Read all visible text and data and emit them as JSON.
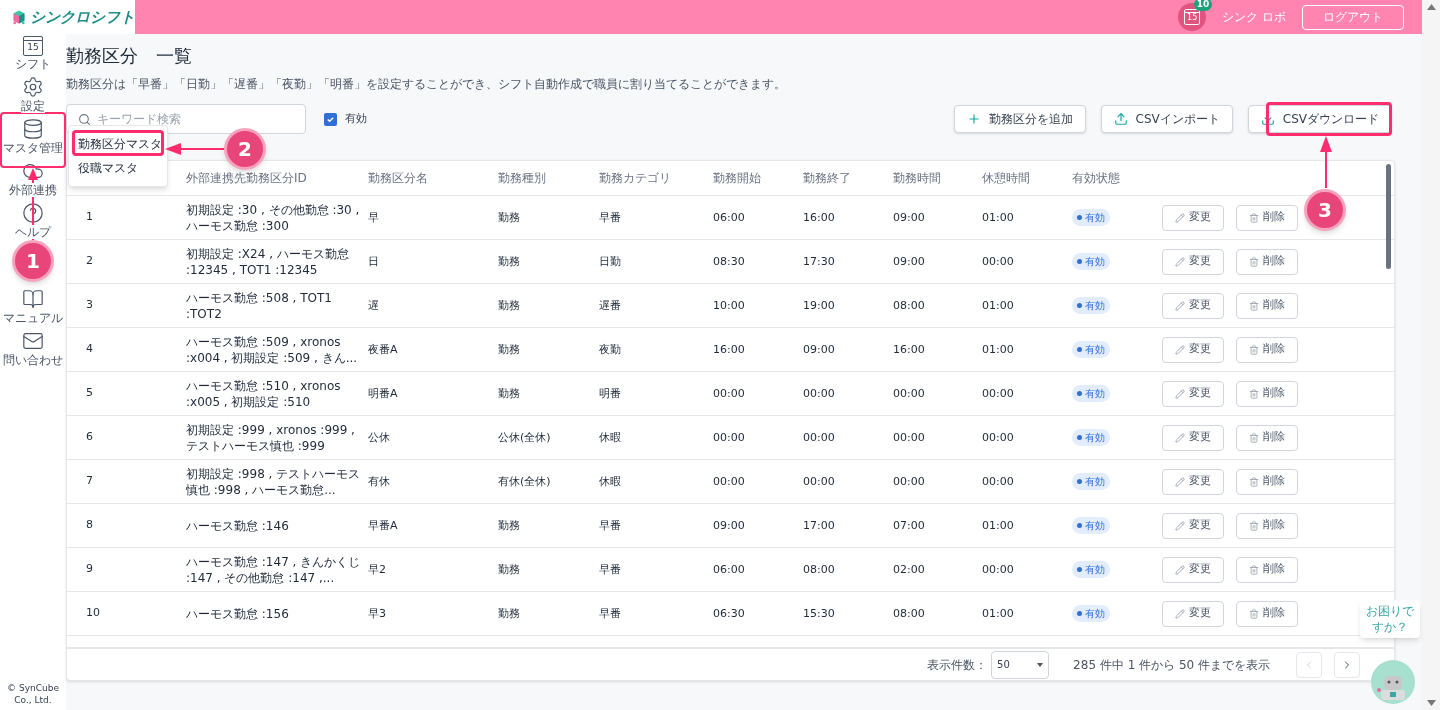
{
  "app": {
    "name": "シンクロシフト"
  },
  "header": {
    "calendar_day": "15",
    "notification_count": "10",
    "user": "シンク ロボ",
    "logout": "ログアウト"
  },
  "sidebar": {
    "items": [
      {
        "label": "シフト",
        "kind": "calendar",
        "day": "15"
      },
      {
        "label": "設定",
        "kind": "gear"
      },
      {
        "label": "マスタ管理",
        "kind": "database"
      },
      {
        "label": "外部連携",
        "kind": "cloud"
      },
      {
        "label": "ヘルプ",
        "kind": "help"
      },
      {
        "label": "マニュアル",
        "kind": "book"
      },
      {
        "label": "問い合わせ",
        "kind": "mail"
      }
    ],
    "footer": "© SynCube Co., Ltd."
  },
  "menu": {
    "items": [
      {
        "label": "勤務区分マスタ"
      },
      {
        "label": "役職マスタ"
      }
    ]
  },
  "page": {
    "title": "勤務区分　一覧",
    "description": "勤務区分は「早番」「日勤」「遅番」「夜勤」「明番」を設定することができ、シフト自動作成で職員に割り当てることができます。",
    "search": {
      "placeholder": "キーワード検索"
    },
    "filter": {
      "label": "有効",
      "checked": true
    },
    "buttons": [
      {
        "label": "勤務区分を追加",
        "kind": "add"
      },
      {
        "label": "CSVインポート",
        "kind": "upload"
      },
      {
        "label": "CSVダウンロード",
        "kind": "download"
      }
    ]
  },
  "table": {
    "columns": [
      "外部連携先勤務区分ID",
      "勤務区分名",
      "勤務種別",
      "勤務カテゴリ",
      "勤務開始",
      "勤務終了",
      "勤務時間",
      "休憩時間",
      "有効状態"
    ],
    "rows": [
      {
        "no": "1",
        "ext_id": "初期設定 :30 , その他勤怠 :30 , ハーモス勤怠 :300",
        "name": "早",
        "type": "勤務",
        "category": "早番",
        "start": "06:00",
        "end": "16:00",
        "duration": "09:00",
        "break": "01:00",
        "status": "有効",
        "active": true,
        "edit": "変更",
        "delete": "削除"
      },
      {
        "no": "2",
        "ext_id": "初期設定 :X24 , ハーモス勤怠 :12345 , TOT1 :12345",
        "name": "日",
        "type": "勤務",
        "category": "日勤",
        "start": "08:30",
        "end": "17:30",
        "duration": "09:00",
        "break": "00:00",
        "status": "有効",
        "active": true,
        "edit": "変更",
        "delete": "削除"
      },
      {
        "no": "3",
        "ext_id": "ハーモス勤怠 :508 , TOT1 :TOT2",
        "name": "遅",
        "type": "勤務",
        "category": "遅番",
        "start": "10:00",
        "end": "19:00",
        "duration": "08:00",
        "break": "01:00",
        "status": "有効",
        "active": true,
        "edit": "変更",
        "delete": "削除"
      },
      {
        "no": "4",
        "ext_id": "ハーモス勤怠 :509 , xronos :x004 , 初期設定 :509 , きん...",
        "name": "夜番A",
        "type": "勤務",
        "category": "夜勤",
        "start": "16:00",
        "end": "09:00",
        "duration": "16:00",
        "break": "01:00",
        "status": "有効",
        "active": true,
        "edit": "変更",
        "delete": "削除"
      },
      {
        "no": "5",
        "ext_id": "ハーモス勤怠 :510 , xronos :x005 , 初期設定 :510",
        "name": "明番A",
        "type": "勤務",
        "category": "明番",
        "start": "00:00",
        "end": "00:00",
        "duration": "00:00",
        "break": "00:00",
        "status": "有効",
        "active": true,
        "edit": "変更",
        "delete": "削除"
      },
      {
        "no": "6",
        "ext_id": "初期設定 :999 , xronos :999 , テストハーモス慎也 :999",
        "name": "公休",
        "type": "公休(全休)",
        "category": "休暇",
        "start": "00:00",
        "end": "00:00",
        "duration": "00:00",
        "break": "00:00",
        "status": "有効",
        "active": true,
        "edit": "変更",
        "delete": "削除"
      },
      {
        "no": "7",
        "ext_id": "初期設定 :998 , テストハーモス慎也 :998 , ハーモス勤怠...",
        "name": "有休",
        "type": "有休(全休)",
        "category": "休暇",
        "start": "00:00",
        "end": "00:00",
        "duration": "00:00",
        "break": "00:00",
        "status": "有効",
        "active": true,
        "edit": "変更",
        "delete": "削除"
      },
      {
        "no": "8",
        "ext_id": "ハーモス勤怠 :146",
        "name": "早番A",
        "type": "勤務",
        "category": "早番",
        "start": "09:00",
        "end": "17:00",
        "duration": "07:00",
        "break": "01:00",
        "status": "有効",
        "active": true,
        "edit": "変更",
        "delete": "削除"
      },
      {
        "no": "9",
        "ext_id": "ハーモス勤怠 :147 , きんかくじ :147 , その他勤怠 :147 ,...",
        "name": "早2",
        "type": "勤務",
        "category": "早番",
        "start": "06:00",
        "end": "08:00",
        "duration": "02:00",
        "break": "00:00",
        "status": "有効",
        "active": true,
        "edit": "変更",
        "delete": "削除"
      },
      {
        "no": "10",
        "ext_id": "ハーモス勤怠 :156",
        "name": "早3",
        "type": "勤務",
        "category": "早番",
        "start": "06:30",
        "end": "15:30",
        "duration": "08:00",
        "break": "01:00",
        "status": "有効",
        "active": true,
        "edit": "変更",
        "delete": "削除"
      }
    ]
  },
  "pagination": {
    "per_page_label": "表示件数：",
    "per_page": "50",
    "summary": "285 件中 1 件から 50 件までを表示"
  },
  "help": {
    "text": "お困りですか？"
  },
  "annotations": [
    {
      "number": "1"
    },
    {
      "number": "2"
    },
    {
      "number": "3"
    }
  ]
}
